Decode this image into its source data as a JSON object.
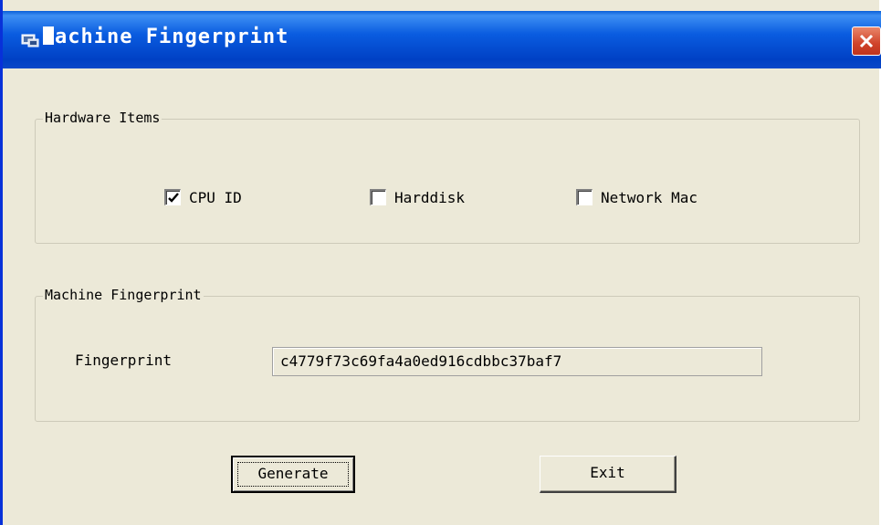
{
  "window": {
    "title": "Machine Fingerprint",
    "title_rest": "achine Fingerprint",
    "icon": "app-icon",
    "close_icon": "close-icon"
  },
  "hardware_group": {
    "legend": "Hardware Items",
    "items": [
      {
        "label": "CPU ID",
        "checked": true
      },
      {
        "label": "Harddisk",
        "checked": false
      },
      {
        "label": "Network Mac",
        "checked": false
      }
    ]
  },
  "fingerprint_group": {
    "legend": "Machine Fingerprint",
    "label": "Fingerprint",
    "value": "c4779f73c69fa4a0ed916cdbbc37baf7"
  },
  "buttons": {
    "generate": "Generate",
    "exit": "Exit"
  },
  "colors": {
    "titlebar": "#0a5ce0",
    "dialog_bg": "#ece9d8",
    "close_button": "#d0432a"
  }
}
